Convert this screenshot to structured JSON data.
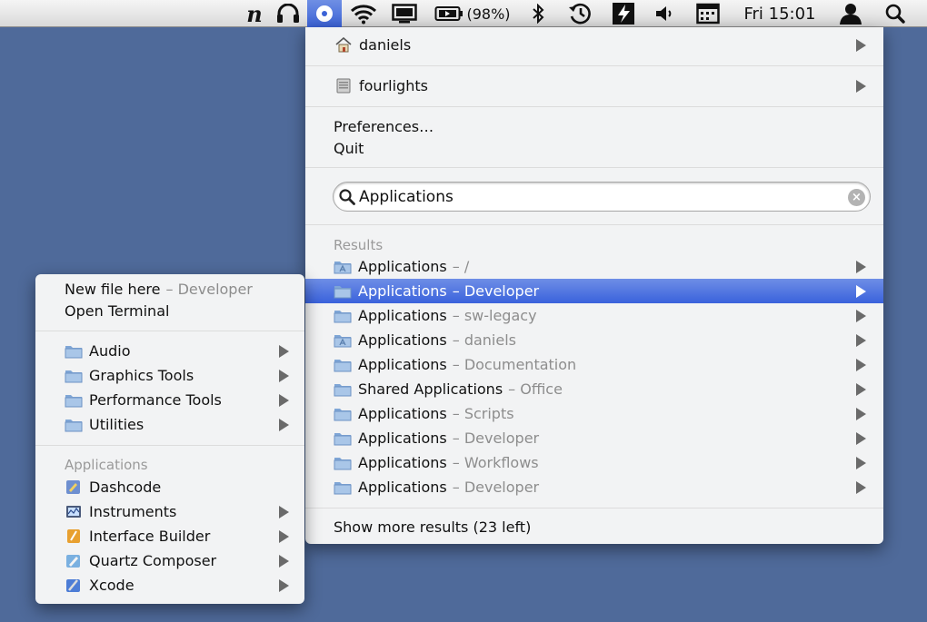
{
  "menubar": {
    "n_app_glyph": "n",
    "battery_text": "(98%)",
    "clock": "Fri 15:01",
    "icons": [
      "n-app-icon",
      "headphones-icon",
      "target-icon",
      "wifi-icon",
      "display-icon",
      "battery-icon",
      "bluetooth-icon",
      "time-machine-icon",
      "flash-icon",
      "volume-icon",
      "calendar-icon",
      "user-icon",
      "spotlight-icon"
    ]
  },
  "main_menu": {
    "places": [
      {
        "label": "daniels",
        "icon": "home-icon"
      },
      {
        "label": "fourlights",
        "icon": "drive-icon"
      }
    ],
    "preferences_label": "Preferences…",
    "quit_label": "Quit",
    "search": {
      "value": "Applications",
      "placeholder": ""
    },
    "results_label": "Results",
    "results": [
      {
        "name": "Applications",
        "context": "– /",
        "icon": "apps-folder-icon"
      },
      {
        "name": "Applications",
        "context": "– Developer",
        "icon": "folder-icon",
        "selected": true
      },
      {
        "name": "Applications",
        "context": "– sw-legacy",
        "icon": "folder-icon"
      },
      {
        "name": "Applications",
        "context": "– daniels",
        "icon": "apps-folder-icon"
      },
      {
        "name": "Applications",
        "context": "– Documentation",
        "icon": "folder-icon"
      },
      {
        "name": "Shared Applications",
        "context": "– Office",
        "icon": "folder-icon"
      },
      {
        "name": "Applications",
        "context": "– Scripts",
        "icon": "folder-icon"
      },
      {
        "name": "Applications",
        "context": "– Developer",
        "icon": "folder-icon"
      },
      {
        "name": "Applications",
        "context": "– Workflows",
        "icon": "folder-icon"
      },
      {
        "name": "Applications",
        "context": "– Developer",
        "icon": "folder-icon"
      }
    ],
    "show_more_label": "Show more results (23 left)"
  },
  "sub_menu": {
    "new_file_label": "New file here",
    "new_file_context": "– Developer",
    "open_terminal_label": "Open Terminal",
    "folders": [
      {
        "label": "Audio"
      },
      {
        "label": "Graphics Tools"
      },
      {
        "label": "Performance Tools"
      },
      {
        "label": "Utilities"
      }
    ],
    "applications_label": "Applications",
    "apps": [
      {
        "label": "Dashcode",
        "icon": "dashcode-icon",
        "has_arrow": false
      },
      {
        "label": "Instruments",
        "icon": "instruments-icon",
        "has_arrow": true
      },
      {
        "label": "Interface Builder",
        "icon": "interface-builder-icon",
        "has_arrow": true
      },
      {
        "label": "Quartz Composer",
        "icon": "quartz-composer-icon",
        "has_arrow": true
      },
      {
        "label": "Xcode",
        "icon": "xcode-icon",
        "has_arrow": true
      }
    ]
  },
  "colors": {
    "desktop": "#4f6a9a",
    "selection": "#3a62dc",
    "folder": "#8fb2dc"
  }
}
